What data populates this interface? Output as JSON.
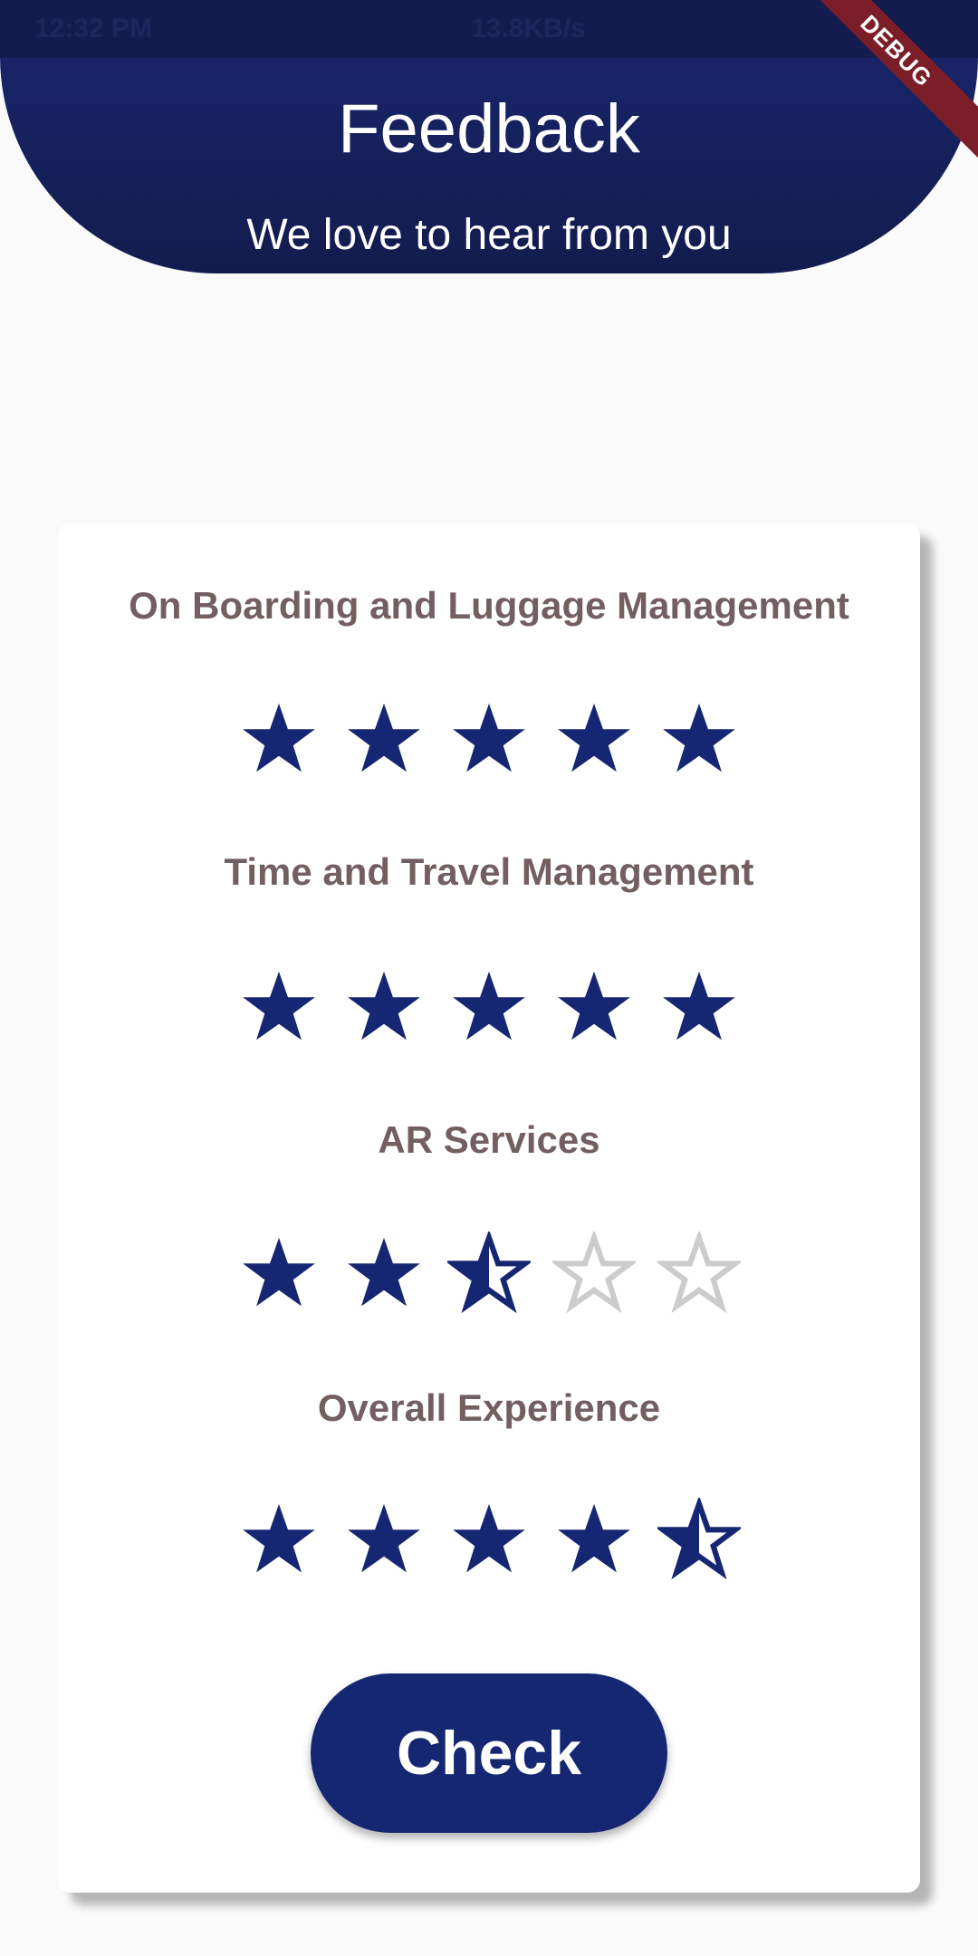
{
  "status_bar": {
    "time": "12:32 PM",
    "network_speed": "13.8KB/s"
  },
  "header": {
    "title": "Feedback",
    "subtitle": "We love to hear from you"
  },
  "debug_banner": "DEBUG",
  "colors": {
    "primary": "#152672",
    "star_empty": "#cccccc",
    "label": "#735f5f",
    "card_bg": "#ffffff",
    "page_bg": "#fafafa"
  },
  "ratings": [
    {
      "label": "On Boarding and Luggage Management",
      "value": 5,
      "max": 5
    },
    {
      "label": "Time and Travel Management",
      "value": 5,
      "max": 5
    },
    {
      "label": "AR Services",
      "value": 2.5,
      "max": 5
    },
    {
      "label": "Overall Experience",
      "value": 4.5,
      "max": 5
    }
  ],
  "check_button": "Check"
}
